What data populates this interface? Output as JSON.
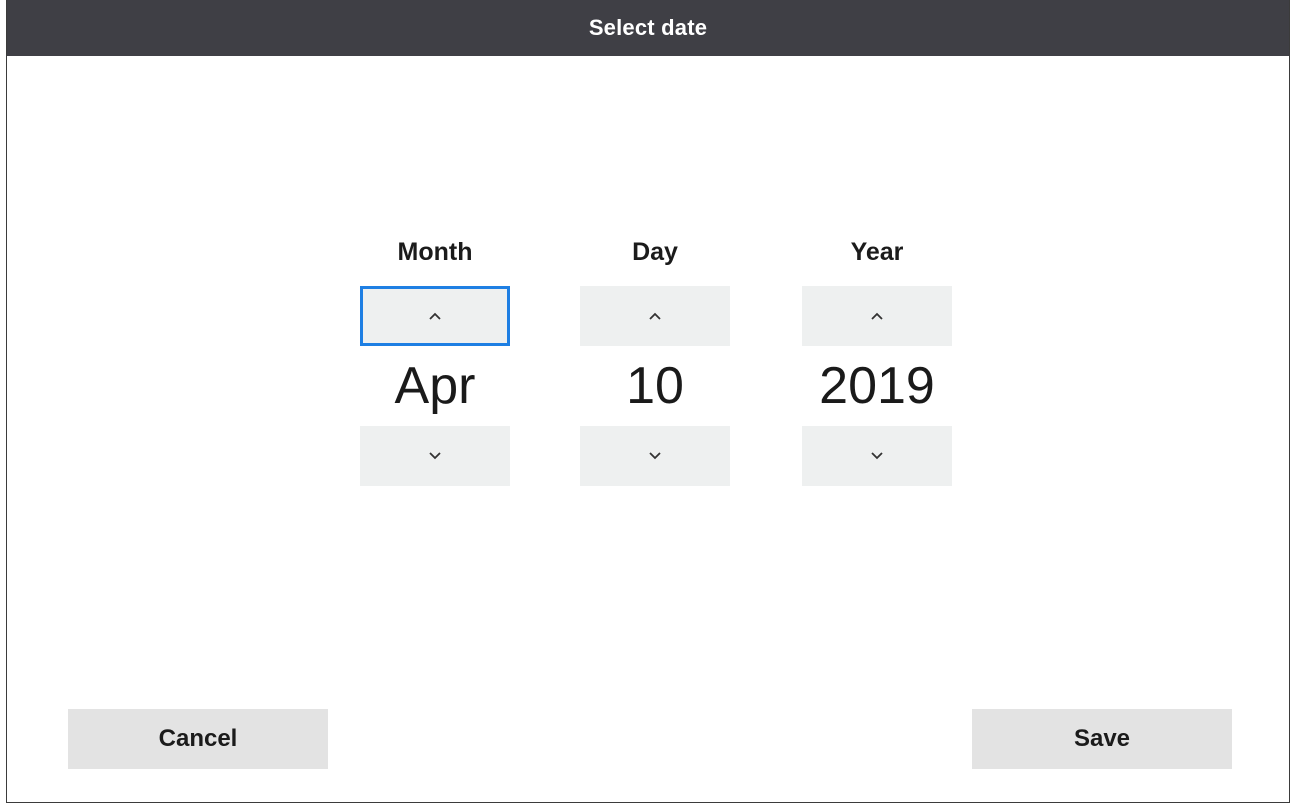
{
  "dialog": {
    "title": "Select date"
  },
  "picker": {
    "month": {
      "label": "Month",
      "value": "Apr"
    },
    "day": {
      "label": "Day",
      "value": "10"
    },
    "year": {
      "label": "Year",
      "value": "2019"
    },
    "up_glyph": "^",
    "down_glyph": "v"
  },
  "actions": {
    "cancel_label": "Cancel",
    "save_label": "Save"
  },
  "colors": {
    "titlebar_bg": "#3f3f45",
    "focus_outline": "#1e7fe3",
    "spin_button_bg": "#eef0f0",
    "action_button_bg": "#e3e3e3"
  }
}
